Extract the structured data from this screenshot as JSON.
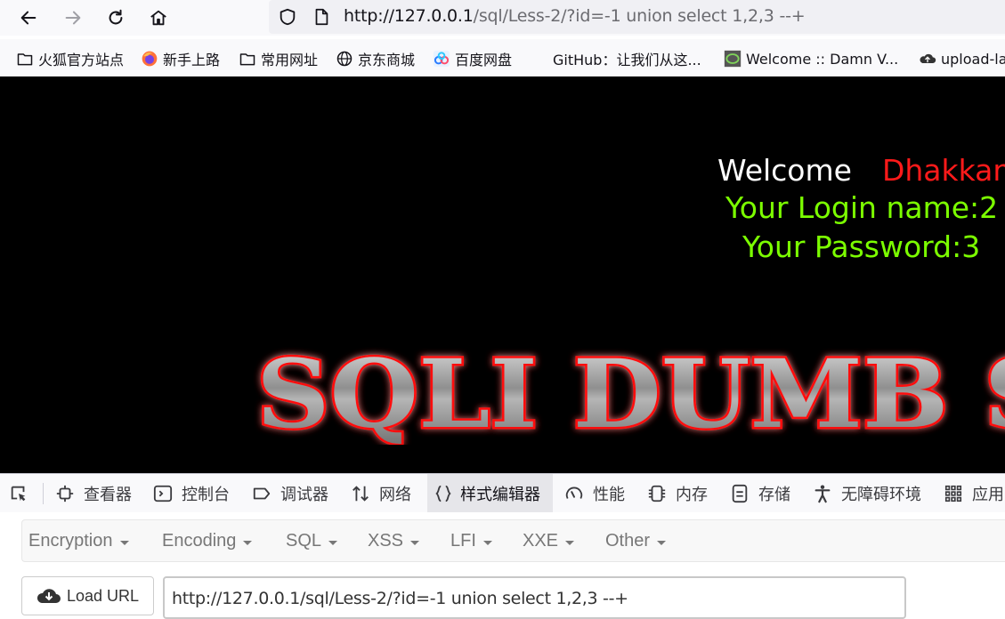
{
  "browser": {
    "url_host": "http://127.0.0.1",
    "url_path": "/sql/Less-2/?id=-1 union select 1,2,3 --+",
    "bookmarks": [
      {
        "label": "火狐官方站点",
        "icon": "folder-icon"
      },
      {
        "label": "新手上路",
        "icon": "firefox-icon"
      },
      {
        "label": "常用网址",
        "icon": "folder-icon"
      },
      {
        "label": "京东商城",
        "icon": "globe-icon"
      },
      {
        "label": "百度网盘",
        "icon": "baidu-pan-icon"
      },
      {
        "label": "GitHub：让我们从这...",
        "icon": "github-icon"
      },
      {
        "label": "Welcome :: Damn V...",
        "icon": "dvwa-icon"
      },
      {
        "label": "upload-la",
        "icon": "upload-icon"
      }
    ]
  },
  "page": {
    "welcome": "Welcome",
    "name": "Dhakkan",
    "login_line": "Your Login name:2",
    "password_line": "Your Password:3",
    "banner_text": "SQLI DUMB S"
  },
  "devtools": {
    "tabs": [
      {
        "label": "查看器",
        "icon": "inspector-icon"
      },
      {
        "label": "控制台",
        "icon": "console-icon"
      },
      {
        "label": "调试器",
        "icon": "debugger-icon"
      },
      {
        "label": "网络",
        "icon": "network-icon"
      },
      {
        "label": "样式编辑器",
        "icon": "style-editor-icon"
      },
      {
        "label": "性能",
        "icon": "performance-icon"
      },
      {
        "label": "内存",
        "icon": "memory-icon"
      },
      {
        "label": "存储",
        "icon": "storage-icon"
      },
      {
        "label": "无障碍环境",
        "icon": "accessibility-icon"
      },
      {
        "label": "应用",
        "icon": "application-icon"
      }
    ]
  },
  "hackbar": {
    "menus": [
      "Encryption",
      "Encoding",
      "SQL",
      "XSS",
      "LFI",
      "XXE",
      "Other"
    ],
    "load_url": "Load URL",
    "url_value": "http://127.0.0.1/sql/Less-2/?id=-1 union select 1,2,3 --+"
  },
  "colors": {
    "login_green": "#7cff00",
    "name_red": "#ff1a1a",
    "banner_glow": "#ff0000"
  }
}
